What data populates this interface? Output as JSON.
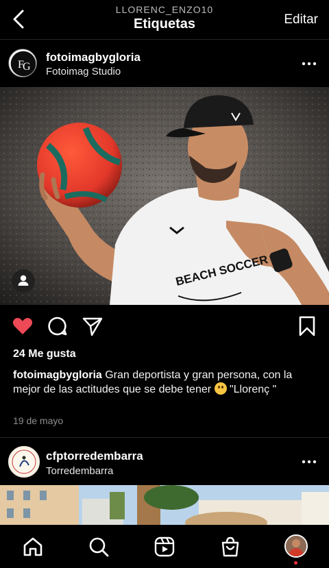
{
  "header": {
    "username": "LLORENC_ENZO10",
    "title": "Etiquetas",
    "edit_label": "Editar"
  },
  "post": {
    "author": "fotoimagbygloria",
    "location": "Fotoimag Studio",
    "avatar_monogram": "FG",
    "shirt_text": "BEACH SOCCER",
    "likes": "24 Me gusta",
    "caption_user": "fotoimagbygloria",
    "caption_text_1": " Gran deportista y gran persona, con la mejor de las actitudes que se debe tener ",
    "caption_text_2": " \"Llorenç \"",
    "date": "19 de mayo",
    "liked": true,
    "like_color": "#ed4956"
  },
  "next_post": {
    "author": "cfptorredembarra",
    "location": "Torredembarra"
  },
  "icons": {
    "back": "chevron-left-icon",
    "more": "more-icon",
    "like": "heart-icon",
    "comment": "comment-icon",
    "share": "send-icon",
    "save": "bookmark-icon",
    "tag": "person-icon",
    "nav": [
      "home-icon",
      "search-icon",
      "reels-icon",
      "shop-icon",
      "profile-avatar"
    ]
  }
}
